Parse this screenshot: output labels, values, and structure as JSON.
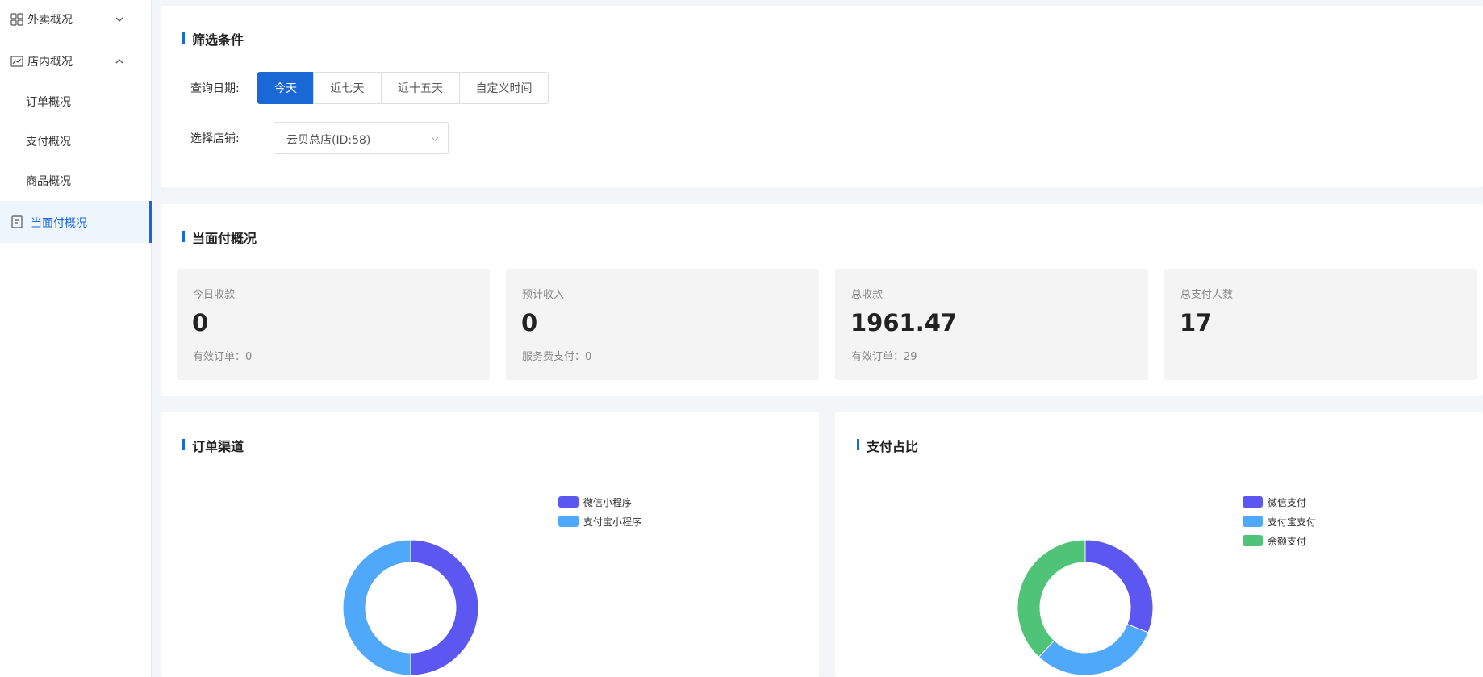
{
  "sidebar": {
    "items": [
      {
        "label": "外卖概况"
      },
      {
        "label": "店内概况"
      },
      {
        "label": "订单概况"
      },
      {
        "label": "支付概况"
      },
      {
        "label": "商品概况"
      },
      {
        "label": "当面付概况"
      }
    ]
  },
  "filter": {
    "title": "筛选条件",
    "date_label": "查询日期:",
    "date_options": [
      "今天",
      "近七天",
      "近十五天",
      "自定义时间"
    ],
    "store_label": "选择店铺:",
    "store_value": "云贝总店(ID:58)"
  },
  "overview": {
    "title": "当面付概况",
    "stats": [
      {
        "label": "今日收款",
        "value": "0",
        "sub": "有效订单：0"
      },
      {
        "label": "预计收入",
        "value": "0",
        "sub": "服务费支付：0"
      },
      {
        "label": "总收款",
        "value": "1961.47",
        "sub": "有效订单：29"
      },
      {
        "label": "总支付人数",
        "value": "17",
        "sub": ""
      }
    ]
  },
  "colors": {
    "accent": "#1a67d6",
    "purple": "#5b57f0",
    "blue": "#4fa8f9",
    "green": "#4fc478"
  },
  "chart_data": [
    {
      "type": "pie",
      "title": "订单渠道",
      "categories": [
        "微信小程序",
        "支付宝小程序"
      ],
      "values": [
        50,
        50
      ]
    },
    {
      "type": "pie",
      "title": "支付占比",
      "categories": [
        "微信支付",
        "支付宝支付",
        "余额支付"
      ],
      "values": [
        31,
        31,
        38
      ]
    }
  ]
}
